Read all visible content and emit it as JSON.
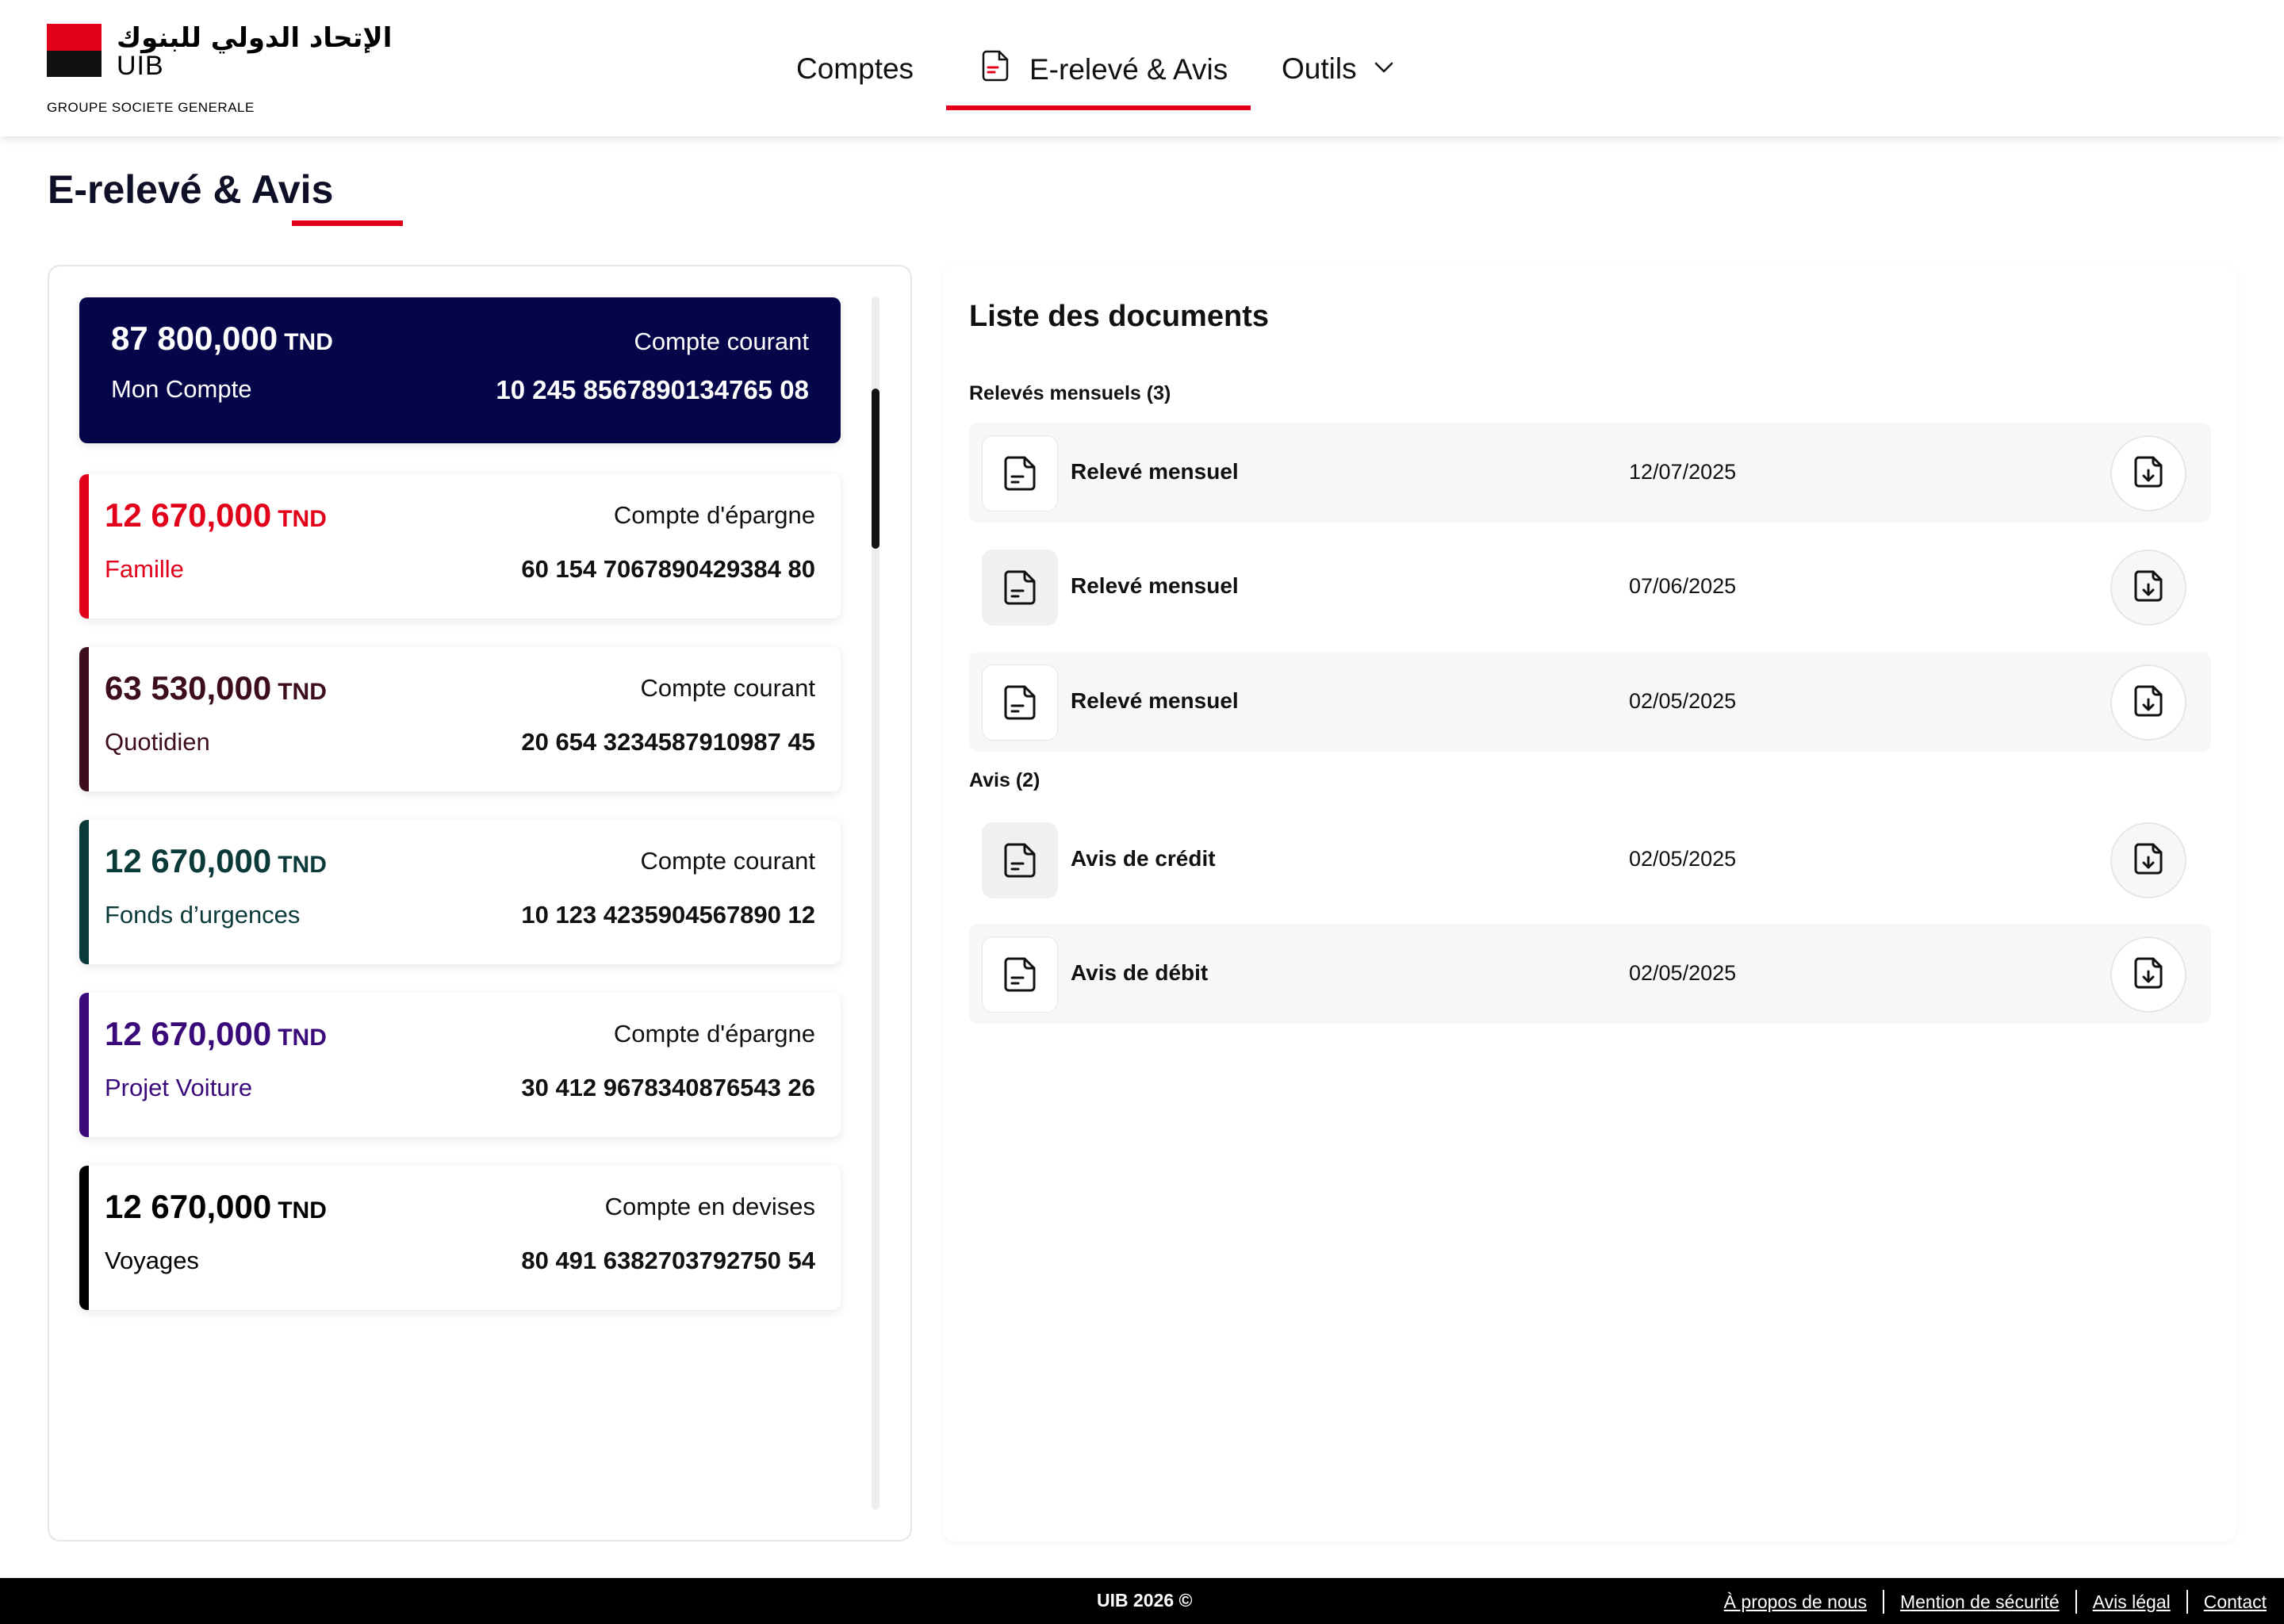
{
  "brand": {
    "arabic_name": "الإتحاد الدولي للبنوك",
    "short_name": "UIB",
    "group": "GROUPE SOCIETE GENERALE",
    "red": "#e2001a"
  },
  "nav": {
    "comptes": "Comptes",
    "ereleve": "E-relevé & Avis",
    "outils": "Outils"
  },
  "page_title": "E-relevé & Avis",
  "accounts": [
    {
      "amount": "87 800,000",
      "currency": "TND",
      "name": "Mon Compte",
      "type": "Compte courant",
      "number": "10 245 8567890134765 08",
      "color": "#050549",
      "selected": true
    },
    {
      "amount": "12 670,000",
      "currency": "TND",
      "name": "Famille",
      "type": "Compte d'épargne",
      "number": "60 154 7067890429384 80",
      "color": "#e2001a"
    },
    {
      "amount": "63 530,000",
      "currency": "TND",
      "name": "Quotidien",
      "type": "Compte courant",
      "number": "20 654 3234587910987 45",
      "color": "#3d0c1e"
    },
    {
      "amount": "12 670,000",
      "currency": "TND",
      "name": "Fonds d’urgences",
      "type": "Compte courant",
      "number": "10 123 4235904567890 12",
      "color": "#0a3a3a"
    },
    {
      "amount": "12 670,000",
      "currency": "TND",
      "name": "Projet Voiture",
      "type": "Compte d'épargne",
      "number": "30 412 9678340876543 26",
      "color": "#3b0a7a"
    },
    {
      "amount": "12 670,000",
      "currency": "TND",
      "name": "Voyages",
      "type": "Compte en devises",
      "number": "80 491 6382703792750 54",
      "color": "#000000"
    }
  ],
  "documents": {
    "title": "Liste des documents",
    "sections": [
      {
        "label": "Relevés mensuels (3)",
        "items": [
          {
            "name": "Relevé mensuel",
            "date": "12/07/2025"
          },
          {
            "name": "Relevé mensuel",
            "date": "07/06/2025"
          },
          {
            "name": "Relevé mensuel",
            "date": "02/05/2025"
          }
        ]
      },
      {
        "label": "Avis (2)",
        "items": [
          {
            "name": "Avis de crédit",
            "date": "02/05/2025"
          },
          {
            "name": "Avis de débit",
            "date": "02/05/2025"
          }
        ]
      }
    ]
  },
  "footer": {
    "copyright": "UIB 2026 ©",
    "links": [
      "À propos de nous",
      "Mention de sécurité",
      "Avis légal",
      "Contact"
    ]
  }
}
